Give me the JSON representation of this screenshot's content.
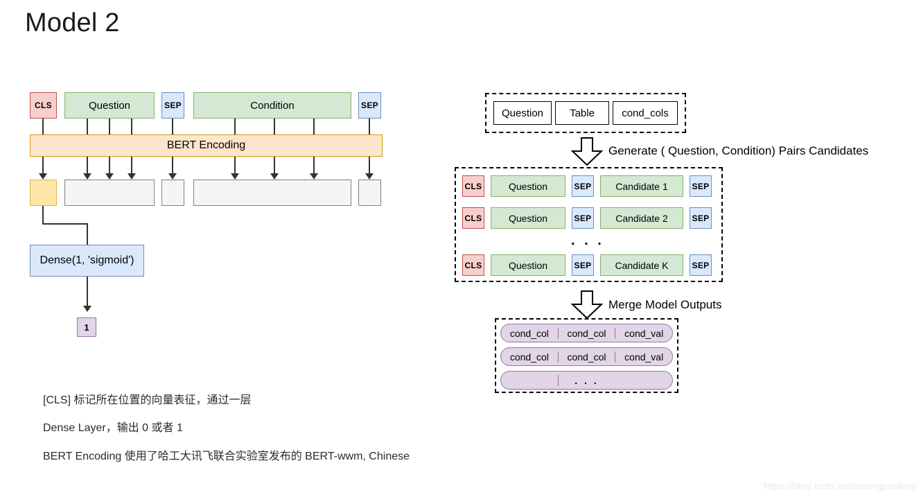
{
  "page": {
    "title": "Model 2",
    "watermark": "https://blog.csdn.net/awangpanfeng"
  },
  "colors": {
    "cls": "#f8cecc",
    "cls_border": "#b85450",
    "sep": "#dae8fc",
    "sep_border": "#6c8ebf",
    "green": "#d5e8d4",
    "green_border": "#82b366",
    "orange": "#fce5cd",
    "orange_border": "#d79b00",
    "yellow": "#ffe6a8",
    "yellow_border": "#d6b656",
    "gray": "#f5f5f5",
    "gray_border": "#808080",
    "blue": "#dae8fc",
    "blue_border": "#6c8ebf",
    "purple": "#e1d5e7",
    "purple_border": "#9673a6"
  },
  "left_diagram": {
    "input_tokens": [
      {
        "label": "CLS",
        "type": "cls"
      },
      {
        "label": "Question",
        "type": "green"
      },
      {
        "label": "SEP",
        "type": "sep"
      },
      {
        "label": "Condition",
        "type": "green"
      },
      {
        "label": "SEP",
        "type": "sep"
      }
    ],
    "encoder": {
      "label": "BERT Encoding"
    },
    "output_tokens": [
      {
        "label": "",
        "type": "yellow"
      },
      {
        "label": "",
        "type": "gray"
      },
      {
        "label": "",
        "type": "gray"
      },
      {
        "label": "",
        "type": "gray"
      },
      {
        "label": "",
        "type": "gray"
      }
    ],
    "dense": {
      "label": "Dense(1, 'sigmoid')"
    },
    "final_output": {
      "label": "1"
    }
  },
  "right_diagram": {
    "inputs": {
      "items": [
        "Question",
        "Table",
        "cond_cols"
      ]
    },
    "step1_label": "Generate ( Question, Condition) Pairs Candidates",
    "candidates": {
      "rows": [
        {
          "cls": "CLS",
          "question": "Question",
          "sep1": "SEP",
          "candidate": "Candidate 1",
          "sep2": "SEP"
        },
        {
          "cls": "CLS",
          "question": "Question",
          "sep1": "SEP",
          "candidate": "Candidate 2",
          "sep2": "SEP"
        },
        {
          "cls": "CLS",
          "question": "Question",
          "sep1": "SEP",
          "candidate": "Candidate K",
          "sep2": "SEP"
        }
      ],
      "ellipsis": ". . ."
    },
    "step2_label": "Merge Model Outputs",
    "results": {
      "rows": [
        [
          "cond_col",
          "cond_col",
          "cond_val"
        ],
        [
          "cond_col",
          "cond_col",
          "cond_val"
        ],
        [
          "",
          ". . .",
          ""
        ]
      ]
    }
  },
  "captions": {
    "line1": "[CLS] 标记所在位置的向量表征，通过一层",
    "line2": "Dense Layer，输出 0 或者 1",
    "line3": "BERT Encoding 使用了哈工大讯飞联合实验室发布的 BERT-wwm, Chinese"
  }
}
